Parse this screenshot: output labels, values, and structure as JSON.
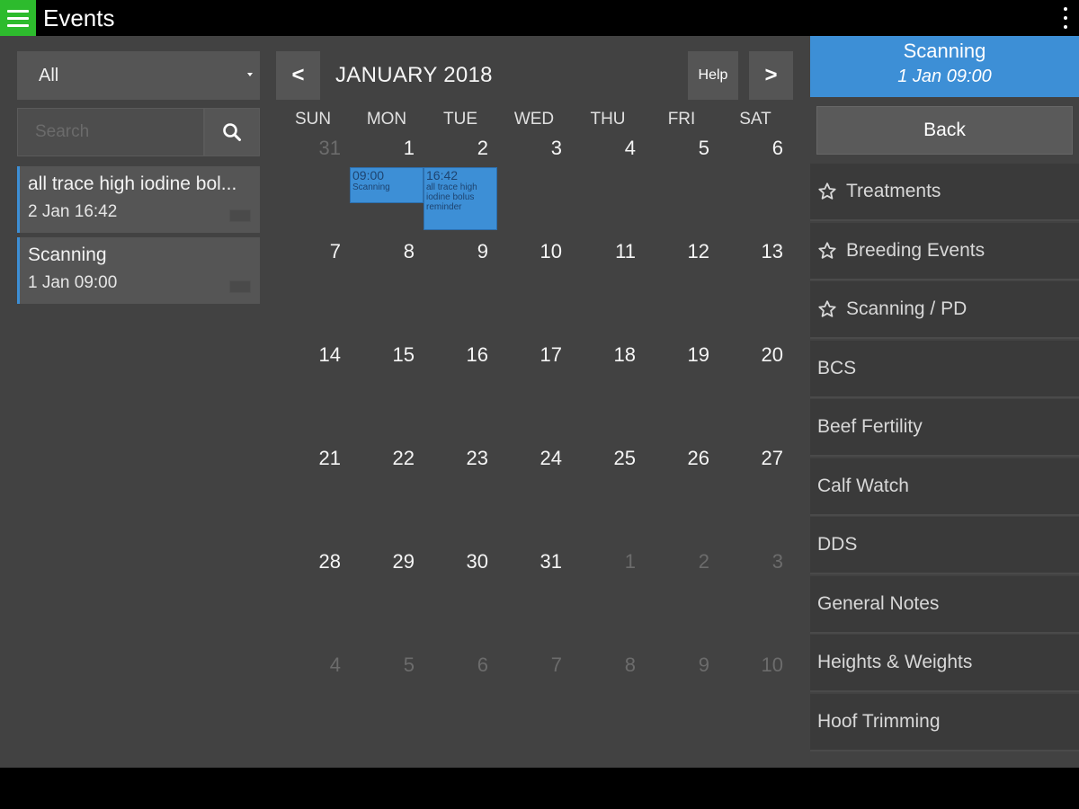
{
  "app": {
    "title": "Events"
  },
  "filter": {
    "selected": "All"
  },
  "search": {
    "placeholder": "Search"
  },
  "event_list": [
    {
      "title": "all trace high iodine bol...",
      "time": "2 Jan 16:42"
    },
    {
      "title": "Scanning",
      "time": "1 Jan 09:00"
    }
  ],
  "calendar": {
    "prev_label": "<",
    "next_label": ">",
    "help_label": "Help",
    "month_title": "JANUARY 2018",
    "weekdays": [
      "SUN",
      "MON",
      "TUE",
      "WED",
      "THU",
      "FRI",
      "SAT"
    ],
    "weeks": [
      [
        "31",
        "1",
        "2",
        "3",
        "4",
        "5",
        "6"
      ],
      [
        "7",
        "8",
        "9",
        "10",
        "11",
        "12",
        "13"
      ],
      [
        "14",
        "15",
        "16",
        "17",
        "18",
        "19",
        "20"
      ],
      [
        "21",
        "22",
        "23",
        "24",
        "25",
        "26",
        "27"
      ],
      [
        "28",
        "29",
        "30",
        "31",
        "1",
        "2",
        "3"
      ],
      [
        "4",
        "5",
        "6",
        "7",
        "8",
        "9",
        "10"
      ]
    ],
    "events": [
      {
        "time": "09:00",
        "name": "Scanning"
      },
      {
        "time": "16:42",
        "name": "all trace high iodine bolus reminder"
      }
    ]
  },
  "selected_event": {
    "title": "Scanning",
    "time": "1 Jan 09:00"
  },
  "right_panel": {
    "back_label": "Back",
    "categories": [
      {
        "label": "Treatments",
        "starred": true
      },
      {
        "label": "Breeding Events",
        "starred": true
      },
      {
        "label": "Scanning / PD",
        "starred": true
      },
      {
        "label": "BCS",
        "starred": false
      },
      {
        "label": "Beef Fertility",
        "starred": false
      },
      {
        "label": "Calf Watch",
        "starred": false
      },
      {
        "label": "DDS",
        "starred": false
      },
      {
        "label": "General Notes",
        "starred": false
      },
      {
        "label": "Heights & Weights",
        "starred": false
      },
      {
        "label": "Hoof Trimming",
        "starred": false
      }
    ]
  },
  "colors": {
    "accent": "#3d8fd6",
    "menu_green": "#2dbb2d",
    "background": "#424242"
  }
}
